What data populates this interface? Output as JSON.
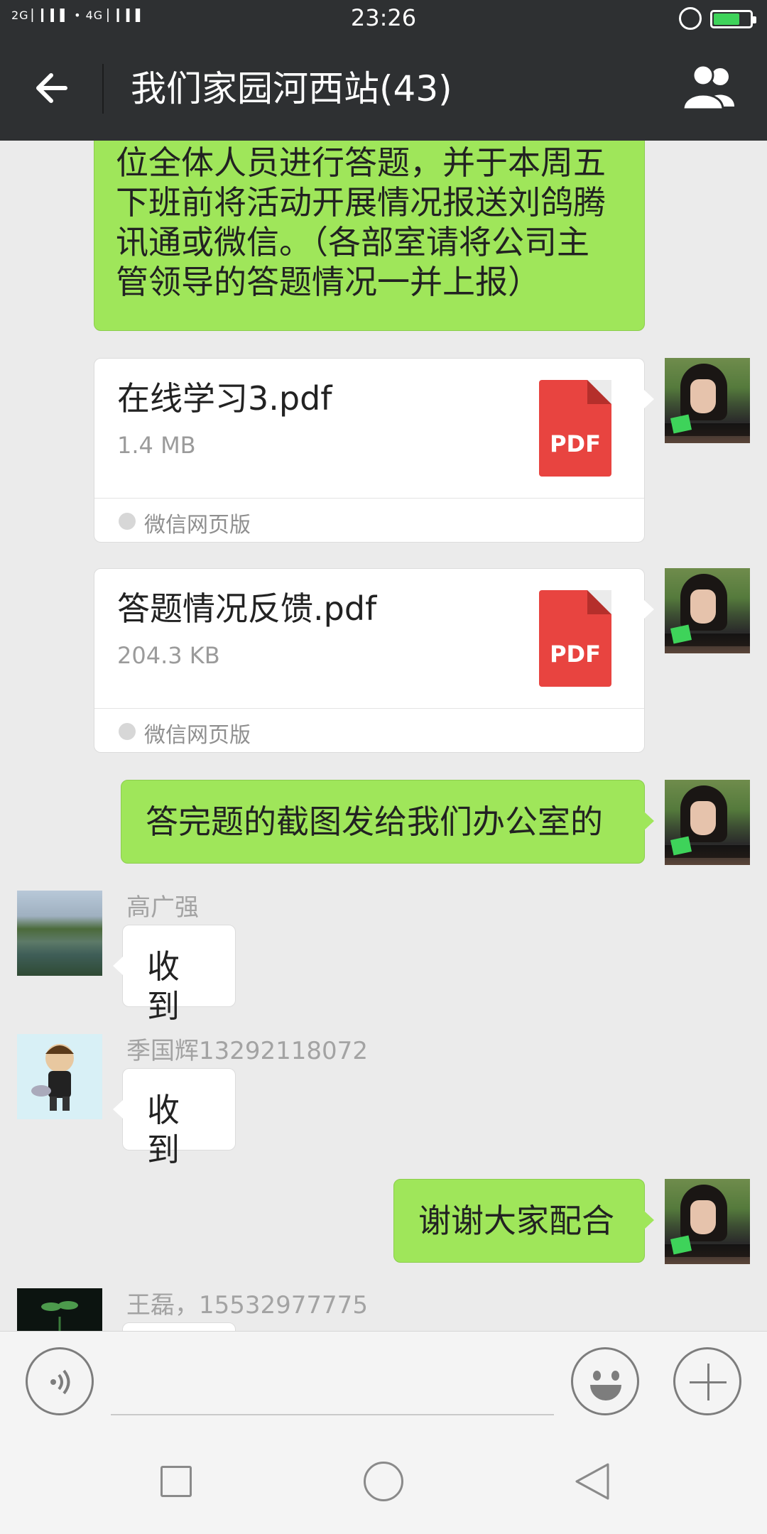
{
  "status_bar": {
    "time": "23:26",
    "signal_text": "2G ▏▎▍▌ • 4G ▏▎▍▌",
    "battery_level": 0.7,
    "battery_color": "#3ed35a"
  },
  "header": {
    "title": "我们家园河西站(43)"
  },
  "messages": {
    "top_text": {
      "line1": "位全体人员进行答题，并于本周五",
      "line2": "下班前将活动开展情况报送刘鸽腾",
      "line3": "讯通或微信。（各部室请将公司主",
      "line4": "管领导的答题情况一并上报）"
    },
    "file1": {
      "name": "在线学习3.pdf",
      "size": "1.4 MB",
      "source": "微信网页版",
      "icon_label": "PDF"
    },
    "file2": {
      "name": "答题情况反馈.pdf",
      "size": "204.3 KB",
      "source": "微信网页版",
      "icon_label": "PDF"
    },
    "msg_screenshot": "答完题的截图发给我们办公室的",
    "gao": {
      "name": "高广强",
      "text": "收到"
    },
    "ji": {
      "name": "季国辉13292118072",
      "text": "收到"
    },
    "msg_thanks": "谢谢大家配合",
    "wang": {
      "name": "王磊，15532977775"
    }
  },
  "colors": {
    "bubble_out": "#9fe65a",
    "header_bg": "#2e3032",
    "pdf_red": "#e84440"
  },
  "icons": [
    "back-arrow-icon",
    "group-members-icon",
    "voice-icon",
    "emoji-icon",
    "plus-icon",
    "pdf-file-icon",
    "nav-square-icon",
    "nav-home-icon",
    "nav-back-icon"
  ]
}
